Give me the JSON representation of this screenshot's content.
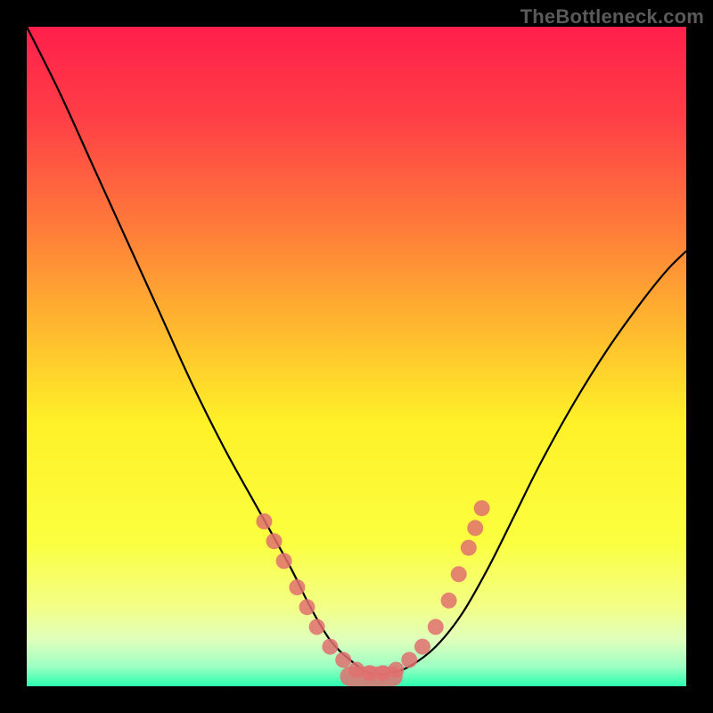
{
  "watermark": "TheBottleneck.com",
  "chart_data": {
    "type": "line",
    "title": "",
    "xlabel": "",
    "ylabel": "",
    "xlim": [
      0,
      100
    ],
    "ylim": [
      0,
      100
    ],
    "background_gradient": {
      "stops": [
        {
          "offset": 0.0,
          "color": "#ff1f4b"
        },
        {
          "offset": 0.14,
          "color": "#ff3f46"
        },
        {
          "offset": 0.3,
          "color": "#ff7a3a"
        },
        {
          "offset": 0.45,
          "color": "#ffb62f"
        },
        {
          "offset": 0.6,
          "color": "#fff128"
        },
        {
          "offset": 0.78,
          "color": "#fbff3f"
        },
        {
          "offset": 0.88,
          "color": "#f3ff87"
        },
        {
          "offset": 0.93,
          "color": "#dfffbc"
        },
        {
          "offset": 0.97,
          "color": "#9dffc3"
        },
        {
          "offset": 1.0,
          "color": "#2bffb0"
        }
      ]
    },
    "series": [
      {
        "name": "bottleneck-curve",
        "color": "#000000",
        "x": [
          0,
          5,
          10,
          15,
          20,
          25,
          30,
          35,
          40,
          43,
          46,
          49,
          52,
          55,
          58,
          62,
          66,
          70,
          74,
          78,
          83,
          88,
          93,
          97,
          100
        ],
        "y": [
          100,
          90,
          79,
          68,
          57,
          46,
          36,
          27,
          18,
          12,
          7,
          4,
          2,
          2,
          3,
          6,
          11,
          18,
          26,
          34,
          43,
          51,
          58,
          63,
          66
        ]
      }
    ],
    "markers": {
      "name": "highlight-dots",
      "color": "#e07070",
      "radius": 9,
      "points": [
        {
          "x": 36,
          "y": 25
        },
        {
          "x": 37.5,
          "y": 22
        },
        {
          "x": 39,
          "y": 19
        },
        {
          "x": 41,
          "y": 15
        },
        {
          "x": 42.5,
          "y": 12
        },
        {
          "x": 44,
          "y": 9
        },
        {
          "x": 46,
          "y": 6
        },
        {
          "x": 48,
          "y": 4
        },
        {
          "x": 50,
          "y": 2.5
        },
        {
          "x": 52,
          "y": 2
        },
        {
          "x": 54,
          "y": 2
        },
        {
          "x": 56,
          "y": 2.5
        },
        {
          "x": 58,
          "y": 4
        },
        {
          "x": 60,
          "y": 6
        },
        {
          "x": 62,
          "y": 9
        },
        {
          "x": 64,
          "y": 13
        },
        {
          "x": 65.5,
          "y": 17
        },
        {
          "x": 67,
          "y": 21
        },
        {
          "x": 68,
          "y": 24
        },
        {
          "x": 69,
          "y": 27
        }
      ]
    },
    "bottom_band": {
      "color": "#e07070",
      "x_start": 47.5,
      "x_end": 57,
      "y": 1.5,
      "thickness": 3
    }
  }
}
